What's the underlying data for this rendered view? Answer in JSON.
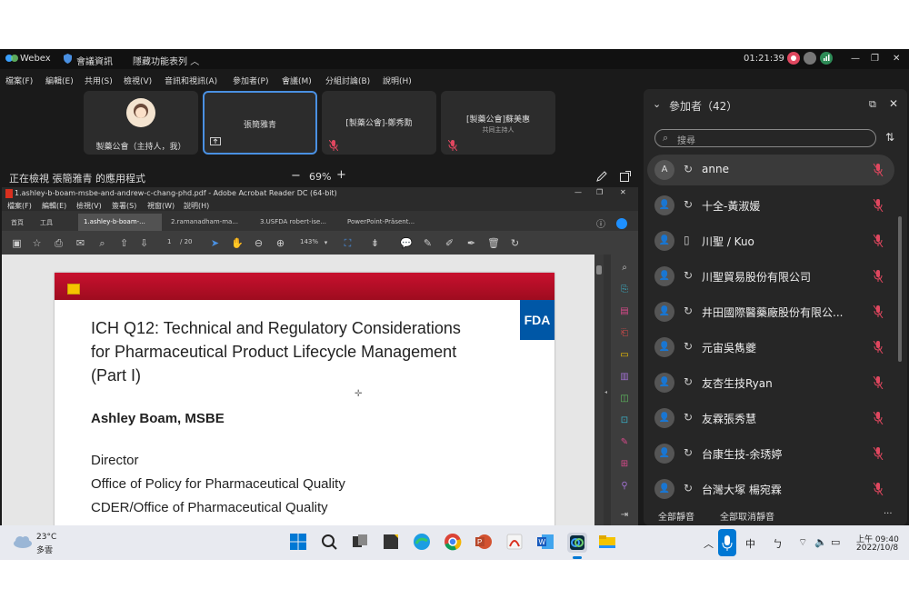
{
  "webex": {
    "app_name": "Webex",
    "meeting_info": "會議資訊",
    "hide_menu": "隱藏功能表列",
    "timer": "01:21:39",
    "menu": [
      "檔案(F)",
      "編輯(E)",
      "共用(S)",
      "檢視(V)",
      "音訊和視訊(A)",
      "參加者(P)",
      "會議(M)",
      "分組討論(B)",
      "說明(H)"
    ]
  },
  "tiles": [
    {
      "name": "製藥公會（主持人，我）",
      "sub": ""
    },
    {
      "name": "張簡雅青",
      "sub": ""
    },
    {
      "name": "[製藥公會]-鄭秀勳",
      "sub": ""
    },
    {
      "name": "[製藥公會]蘇美惠",
      "sub": "共同主持人"
    }
  ],
  "share": {
    "status": "正在檢視 張簡雅青 的應用程式",
    "zoom": "69%",
    "minus": "−",
    "plus": "+"
  },
  "acrobat": {
    "window_title": "1.ashley-b-boam-msbe-and-andrew-c-chang-phd.pdf - Adobe Acrobat Reader DC (64-bit)",
    "menu": [
      "檔案(F)",
      "編輯(E)",
      "檢視(V)",
      "簽署(S)",
      "視窗(W)",
      "說明(H)"
    ],
    "home_tab": "首頁",
    "tools_tab": "工具",
    "tabs": [
      "1.ashley-b-boam-...",
      "2.ramanadham-ma...",
      "3.USFDA robert-ise...",
      "PowerPoint-Präsent..."
    ],
    "page_num": "1",
    "page_total": "/ 20",
    "zoom": "143%"
  },
  "slide": {
    "title_lines": [
      "ICH Q12: Technical and Regulatory Considerations",
      "for Pharmaceutical Product Lifecycle Management",
      "(Part I)"
    ],
    "author": "Ashley Boam, MSBE",
    "roles": [
      "Director",
      "Office of Policy for Pharmaceutical Quality",
      "CDER/Office of Pharmaceutical Quality"
    ],
    "logo": "FDA"
  },
  "participants": {
    "header": "參加者（42）",
    "search_placeholder": "搜尋",
    "list": [
      {
        "avatar": "A",
        "name": "anne"
      },
      {
        "avatar": "",
        "name": "十全-黃淑媛"
      },
      {
        "avatar": "",
        "name": "川聖 / Kuo"
      },
      {
        "avatar": "",
        "name": "川聖貿易股份有限公司"
      },
      {
        "avatar": "",
        "name": "井田國際醫藥廠股份有限公..."
      },
      {
        "avatar": "",
        "name": "元宙吳雋夔"
      },
      {
        "avatar": "",
        "name": "友杏生技Ryan"
      },
      {
        "avatar": "",
        "name": "友霖張秀慧"
      },
      {
        "avatar": "",
        "name": "台康生技-余琇婷"
      },
      {
        "avatar": "",
        "name": "台灣大塚 楊宛霖"
      }
    ],
    "mute_all": "全部靜音",
    "unmute_all": "全部取消靜音",
    "more": "···"
  },
  "taskbar": {
    "temp": "23°C",
    "weather": "多雲",
    "ime1": "中",
    "ime2": "ㄅ",
    "time": "上午 09:40",
    "date": "2022/10/8"
  },
  "colors": {
    "accent": "#4a90e2",
    "mute_red": "#e0475f",
    "slide_red": "#c8102e",
    "fda_blue": "#0057a6"
  }
}
